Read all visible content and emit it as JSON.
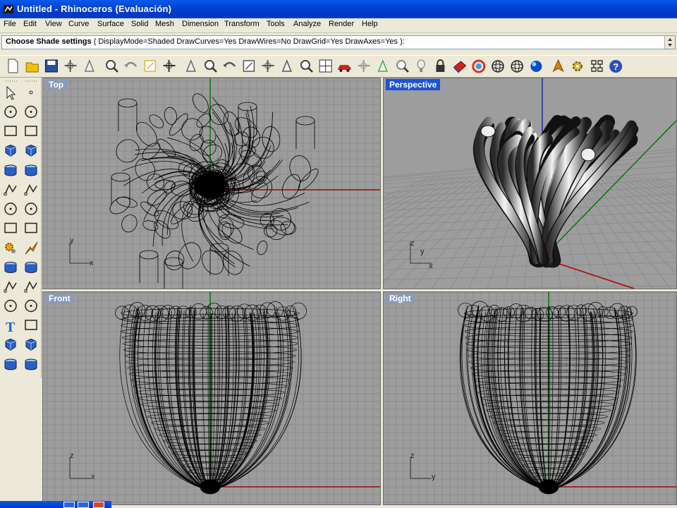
{
  "window": {
    "title": "Untitled - Rhinoceros (Evaluación)"
  },
  "menu": [
    "File",
    "Edit",
    "View",
    "Curve",
    "Surface",
    "Solid",
    "Mesh",
    "Dimension",
    "Transform",
    "Tools",
    "Analyze",
    "Render",
    "Help"
  ],
  "command": {
    "prompt_bold": "Choose Shade settings",
    "prompt_rest": "( DisplayMode=Shaded  DrawCurves=Yes  DrawWires=No  DrawGrid=Yes  DrawAxes=Yes ):"
  },
  "toolbar_icons": [
    "new-icon",
    "open-icon",
    "save-icon",
    "print-icon",
    "import-icon",
    "cut-icon",
    "copy-icon",
    "paste-icon",
    "undo-icon",
    "pan-icon",
    "rotate-view-icon",
    "zoom-dynamic-icon",
    "zoom-window-icon",
    "zoom-extents-icon",
    "zoom-selected-icon",
    "undo-view-icon",
    "four-viewports-icon",
    "car-icon",
    "grid-icon",
    "cplane-icon",
    "points-icon",
    "light-icon",
    "lock-icon",
    "shade-icon",
    "color-wheel-icon",
    "shaded-viewport-icon",
    "wireframe-viewport-icon",
    "render-sphere-icon",
    "arrow-tool-icon",
    "settings-icon",
    "tree-icon",
    "help-icon"
  ],
  "left_tools": [
    "select-icon",
    "point-icon",
    "polyline-icon",
    "curve-edit-icon",
    "circle-icon",
    "ellipse-icon",
    "arc-icon",
    "rectangle-icon",
    "polygon-icon",
    "fillet-curve-icon",
    "surface-icon",
    "extrude-icon",
    "box-icon",
    "spheres-icon",
    "cylinder-icon",
    "plane-icon",
    "gear-icon",
    "explode-icon",
    "trim-icon",
    "split-icon",
    "boolean-icon",
    "group-icon",
    "offset-icon",
    "offset-surface-icon",
    "text-icon",
    "transform-icon",
    "array-icon",
    "scale-icon",
    "solid-icon",
    "dimension-icon"
  ],
  "viewports": {
    "top": {
      "label": "Top",
      "axis_x": "x",
      "axis_y": "y"
    },
    "perspective": {
      "label": "Perspective",
      "axis_x": "x",
      "axis_y": "y",
      "axis_z": "z"
    },
    "front": {
      "label": "Front",
      "axis_x": "x",
      "axis_y": "z"
    },
    "right": {
      "label": "Right",
      "axis_x": "y",
      "axis_y": "z"
    }
  },
  "colors": {
    "viewport_bg": "#9d9d9d",
    "grid": "#8c8c8c",
    "axis_x": "#b00000",
    "axis_y": "#007a00",
    "axis_z": "#2020c0",
    "active_label": "#1c54d8"
  }
}
